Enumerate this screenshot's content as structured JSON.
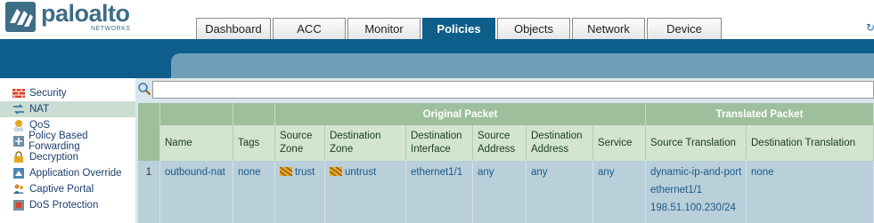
{
  "header": {
    "logo_text": "paloalto",
    "logo_sub": "NETWORKS",
    "tabs": [
      {
        "label": "Dashboard"
      },
      {
        "label": "ACC"
      },
      {
        "label": "Monitor"
      },
      {
        "label": "Policies"
      },
      {
        "label": "Objects"
      },
      {
        "label": "Network"
      },
      {
        "label": "Device"
      }
    ],
    "active_tab": "Policies"
  },
  "sidebar": {
    "items": [
      {
        "label": "Security",
        "icon": "security-rules-icon"
      },
      {
        "label": "NAT",
        "icon": "nat-icon",
        "active": true
      },
      {
        "label": "QoS",
        "icon": "qos-icon"
      },
      {
        "label": "Policy Based Forwarding",
        "icon": "pbf-icon"
      },
      {
        "label": "Decryption",
        "icon": "lock-icon"
      },
      {
        "label": "Application Override",
        "icon": "application-override-icon"
      },
      {
        "label": "Captive Portal",
        "icon": "users-icon"
      },
      {
        "label": "DoS Protection",
        "icon": "dos-protection-icon"
      }
    ]
  },
  "search": {
    "value": "",
    "placeholder": ""
  },
  "table": {
    "groups": {
      "original": "Original Packet",
      "translated": "Translated Packet"
    },
    "columns": {
      "name": "Name",
      "tags": "Tags",
      "source_zone": "Source Zone",
      "destination_zone": "Destination Zone",
      "destination_interface": "Destination Interface",
      "source_address": "Source Address",
      "destination_address": "Destination Address",
      "service": "Service",
      "source_translation": "Source Translation",
      "destination_translation": "Destination Translation"
    },
    "rows": [
      {
        "index": "1",
        "name": "outbound-nat",
        "tags": "none",
        "source_zone": "trust",
        "destination_zone": "untrust",
        "destination_interface": "ethernet1/1",
        "source_address": "any",
        "destination_address": "any",
        "service": "any",
        "source_translation": [
          "dynamic-ip-and-port",
          "ethernet1/1",
          "198.51.100.230/24"
        ],
        "destination_translation": "none"
      }
    ]
  },
  "colors": {
    "brand_blue": "#0d5e8a",
    "header_green": "#9ebf9b",
    "row_blue": "#b9cfda",
    "link": "#1a5a8a"
  }
}
